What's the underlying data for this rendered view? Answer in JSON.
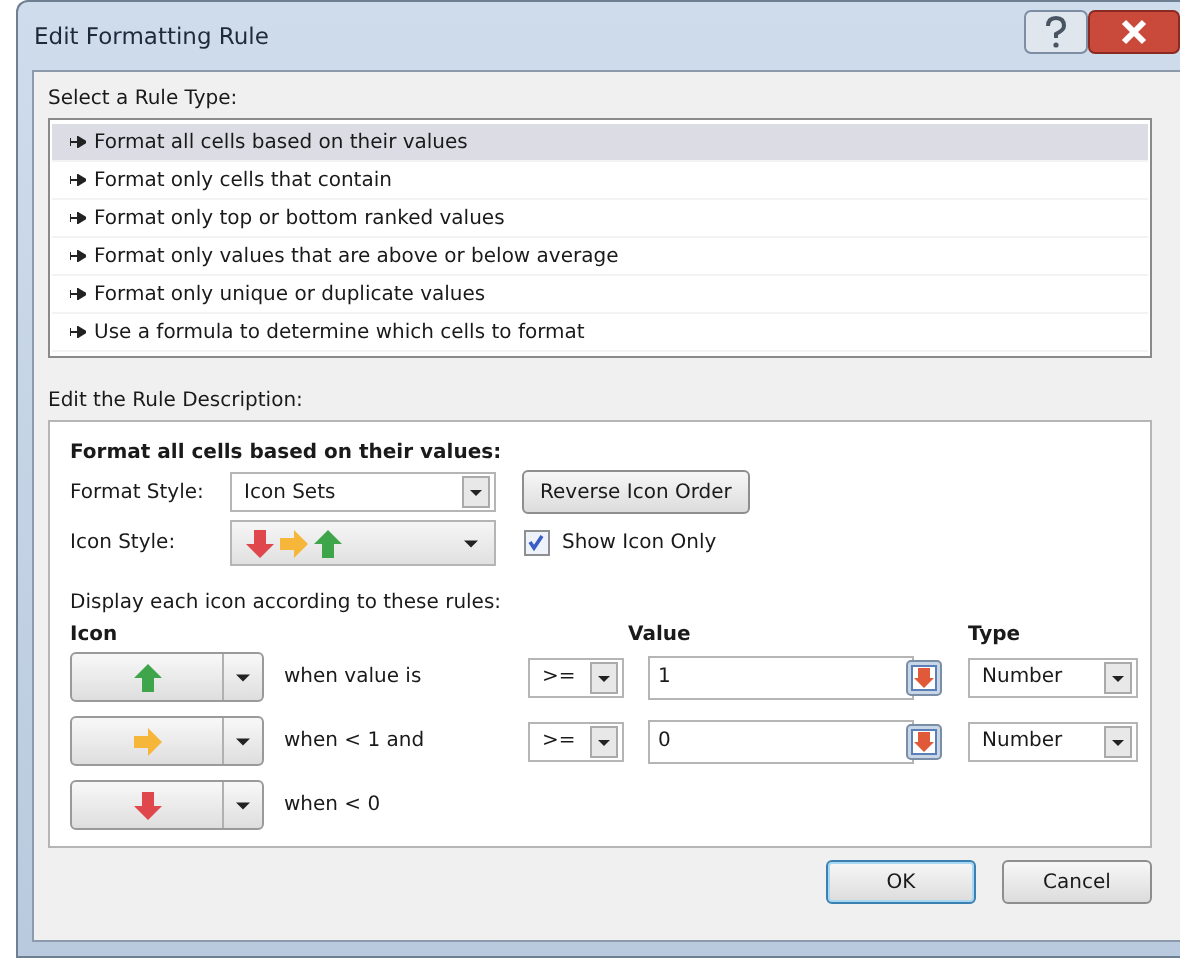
{
  "window": {
    "title": "Edit Formatting Rule"
  },
  "rule_type": {
    "label": "Select a Rule Type:",
    "items": [
      {
        "label": "Format all cells based on their values",
        "selected": true
      },
      {
        "label": "Format only cells that contain",
        "selected": false
      },
      {
        "label": "Format only top or bottom ranked values",
        "selected": false
      },
      {
        "label": "Format only values that are above or below average",
        "selected": false
      },
      {
        "label": "Format only unique or duplicate values",
        "selected": false
      },
      {
        "label": "Use a formula to determine which cells to format",
        "selected": false
      }
    ]
  },
  "description": {
    "label": "Edit the Rule Description:",
    "heading": "Format all cells based on their values:",
    "format_style": {
      "label": "Format Style:",
      "value": "Icon Sets"
    },
    "reverse_button": "Reverse Icon Order",
    "icon_style": {
      "label": "Icon Style:",
      "icons": [
        {
          "kind": "down"
        },
        {
          "kind": "right"
        },
        {
          "kind": "up"
        }
      ]
    },
    "show_icon_only": {
      "label": "Show Icon Only",
      "checked": true
    },
    "rules_label": "Display each icon according to these rules:",
    "columns": {
      "icon": "Icon",
      "value": "Value",
      "type": "Type"
    },
    "rules": [
      {
        "kind": "up",
        "condition": "when value is",
        "operator": ">=",
        "value": "1",
        "type": "Number"
      },
      {
        "kind": "right",
        "condition": "when < 1 and",
        "operator": ">=",
        "value": "0",
        "type": "Number"
      },
      {
        "kind": "down",
        "condition": "when < 0"
      }
    ]
  },
  "buttons": [
    {
      "label": "OK",
      "default": true
    },
    {
      "label": "Cancel",
      "default": false
    }
  ]
}
